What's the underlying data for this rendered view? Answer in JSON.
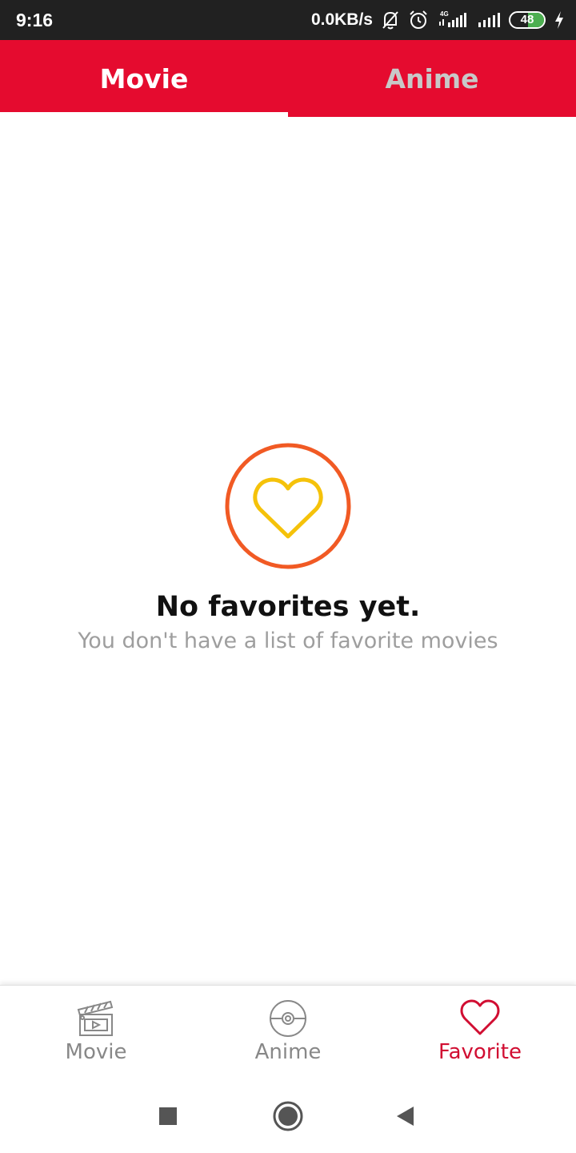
{
  "status_bar": {
    "time": "9:16",
    "network_speed": "0.0KB/s",
    "network_type": "4G",
    "battery_level": "48",
    "icons": [
      "mute-bell-icon",
      "alarm-icon",
      "signal-4g-icon",
      "signal-icon",
      "battery-icon",
      "charging-icon"
    ]
  },
  "top_tabs": [
    {
      "label": "Movie",
      "active": true
    },
    {
      "label": "Anime",
      "active": false
    }
  ],
  "empty_state": {
    "icon": "heart-icon",
    "title": "No favorites yet.",
    "subtitle": "You don't have a list of favorite movies"
  },
  "bottom_nav": [
    {
      "label": "Movie",
      "icon": "clapperboard-icon",
      "active": false
    },
    {
      "label": "Anime",
      "icon": "pokeball-icon",
      "active": false
    },
    {
      "label": "Favorite",
      "icon": "heart-icon",
      "active": true
    }
  ],
  "system_nav": {
    "icons": [
      "recents-square-icon",
      "home-circle-icon",
      "back-triangle-icon"
    ]
  },
  "colors": {
    "status_bar_bg": "#212121",
    "accent_red": "#e50b2f",
    "favorite_active": "#d10e32",
    "empty_circle": "#f15a24",
    "empty_heart": "#f5c20a",
    "battery_green": "#4caf50"
  }
}
